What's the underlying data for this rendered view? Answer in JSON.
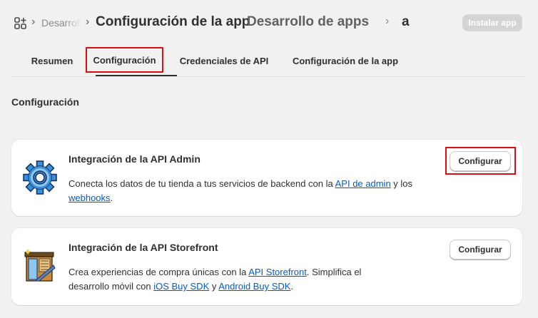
{
  "header": {
    "apps_icon": "apps-grid-icon",
    "breadcrumb_truncated": "Desarrollo de apps",
    "separator": "›",
    "page_title": "Configuración de la app",
    "breadcrumb_dev": "Desarrollo de apps",
    "breadcrumb_app": "a",
    "install_button": "Instalar app"
  },
  "tabs": [
    {
      "label": "Resumen"
    },
    {
      "label": "Configuración"
    },
    {
      "label": "Credenciales de API"
    },
    {
      "label": "Configuración de la app"
    }
  ],
  "section": {
    "title": "Configuración"
  },
  "cards": [
    {
      "icon": "gear-icon",
      "title": "Integración de la API Admin",
      "desc_before": "Conecta los datos de tu tienda a tus servicios de backend con la ",
      "link1": "API de admin",
      "desc_mid": " y los ",
      "link2": "webhooks",
      "desc_after": ".",
      "button": "Configurar"
    },
    {
      "icon": "storefront-icon",
      "title": "Integración de la API Storefront",
      "desc_before": "Crea experiencias de compra únicas con la ",
      "link1": "API Storefront",
      "desc_mid": ". Simplifica el desarrollo móvil con ",
      "link2": "iOS Buy SDK",
      "desc_mid2": " y ",
      "link3": "Android Buy SDK",
      "desc_after": ".",
      "button": "Configurar"
    }
  ],
  "colors": {
    "background": "#f1f1f1",
    "link": "#005bd3",
    "highlight": "#e00b0b",
    "gear_blue": "#3a8fd9"
  }
}
